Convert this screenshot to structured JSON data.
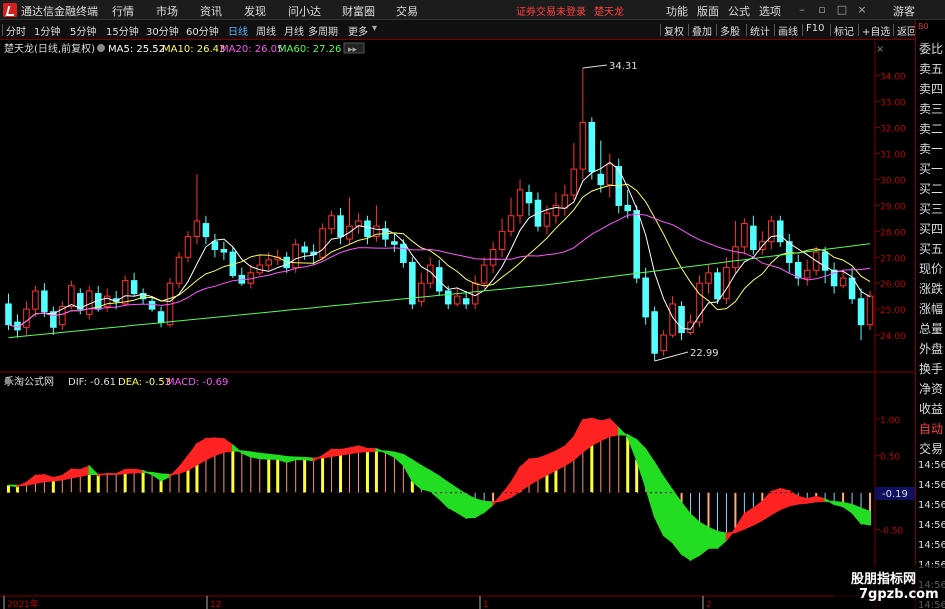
{
  "app": {
    "title": "通达信金融终端",
    "menus": [
      "行情",
      "市场",
      "资讯",
      "发现",
      "问小达",
      "财富圈",
      "交易"
    ],
    "notice": "证券交易未登录",
    "stock_name": "楚天龙",
    "right_menus": [
      "功能",
      "版面",
      "公式",
      "选项"
    ],
    "guest": "游客"
  },
  "tabs": {
    "periods": [
      "分时",
      "1分钟",
      "5分钟",
      "15分钟",
      "30分钟",
      "60分钟",
      "日线",
      "周线",
      "月线",
      "多周期",
      "更多"
    ],
    "active": "日线",
    "right_buttons": [
      "复权",
      "叠加",
      "多股",
      "统计",
      "画线",
      "F10",
      "标记",
      "+自选",
      "返回"
    ]
  },
  "price_panel": {
    "header_name": "楚天龙(日线,前复权)",
    "ma_legend": [
      {
        "label": "MA5: 25.52",
        "color": "#ffffff"
      },
      {
        "label": "MA10: 26.43",
        "color": "#ffff55"
      },
      {
        "label": "MA20: 26.05",
        "color": "#ff55ff"
      },
      {
        "label": "MA60: 27.26",
        "color": "#55ff55"
      }
    ],
    "high_label": "34.31",
    "low_label": "22.99",
    "axis_ticks": [
      "34.00",
      "33.00",
      "32.00",
      "31.00",
      "30.00",
      "29.00",
      "28.00",
      "27.00",
      "26.00",
      "25.00",
      "24.00"
    ]
  },
  "macd_panel": {
    "header_name": "乐淘公式网",
    "dif": "DIF: -0.61",
    "dea": "DEA: -0.53",
    "macd": "MACD: -0.69",
    "axis_ticks": [
      "1.00",
      "0.50",
      "0.00",
      "-0.50"
    ],
    "current_value": "-0.19"
  },
  "time_axis": {
    "labels": [
      "2021年",
      "12",
      "1",
      "2"
    ]
  },
  "side_panel": {
    "top": "B0",
    "items": [
      "委比",
      "卖五",
      "卖四",
      "卖三",
      "卖二",
      "卖一",
      "买一",
      "买二",
      "买三",
      "买四",
      "买五",
      "现价",
      "涨跌",
      "涨幅",
      "总量",
      "外盘",
      "换手",
      "净资",
      "收益",
      "自动",
      "交易",
      "14:56",
      "14:56",
      "14:56",
      "14:56",
      "14:56",
      "14:56",
      "14:56",
      "14:56",
      "14:56"
    ]
  },
  "watermark": {
    "line1": "股朋指标网",
    "line2": "7gpzb.com"
  },
  "colors": {
    "up": "#ff3232",
    "down": "#54ffff",
    "grid": "#800000",
    "axis_text": "#c00000"
  }
}
